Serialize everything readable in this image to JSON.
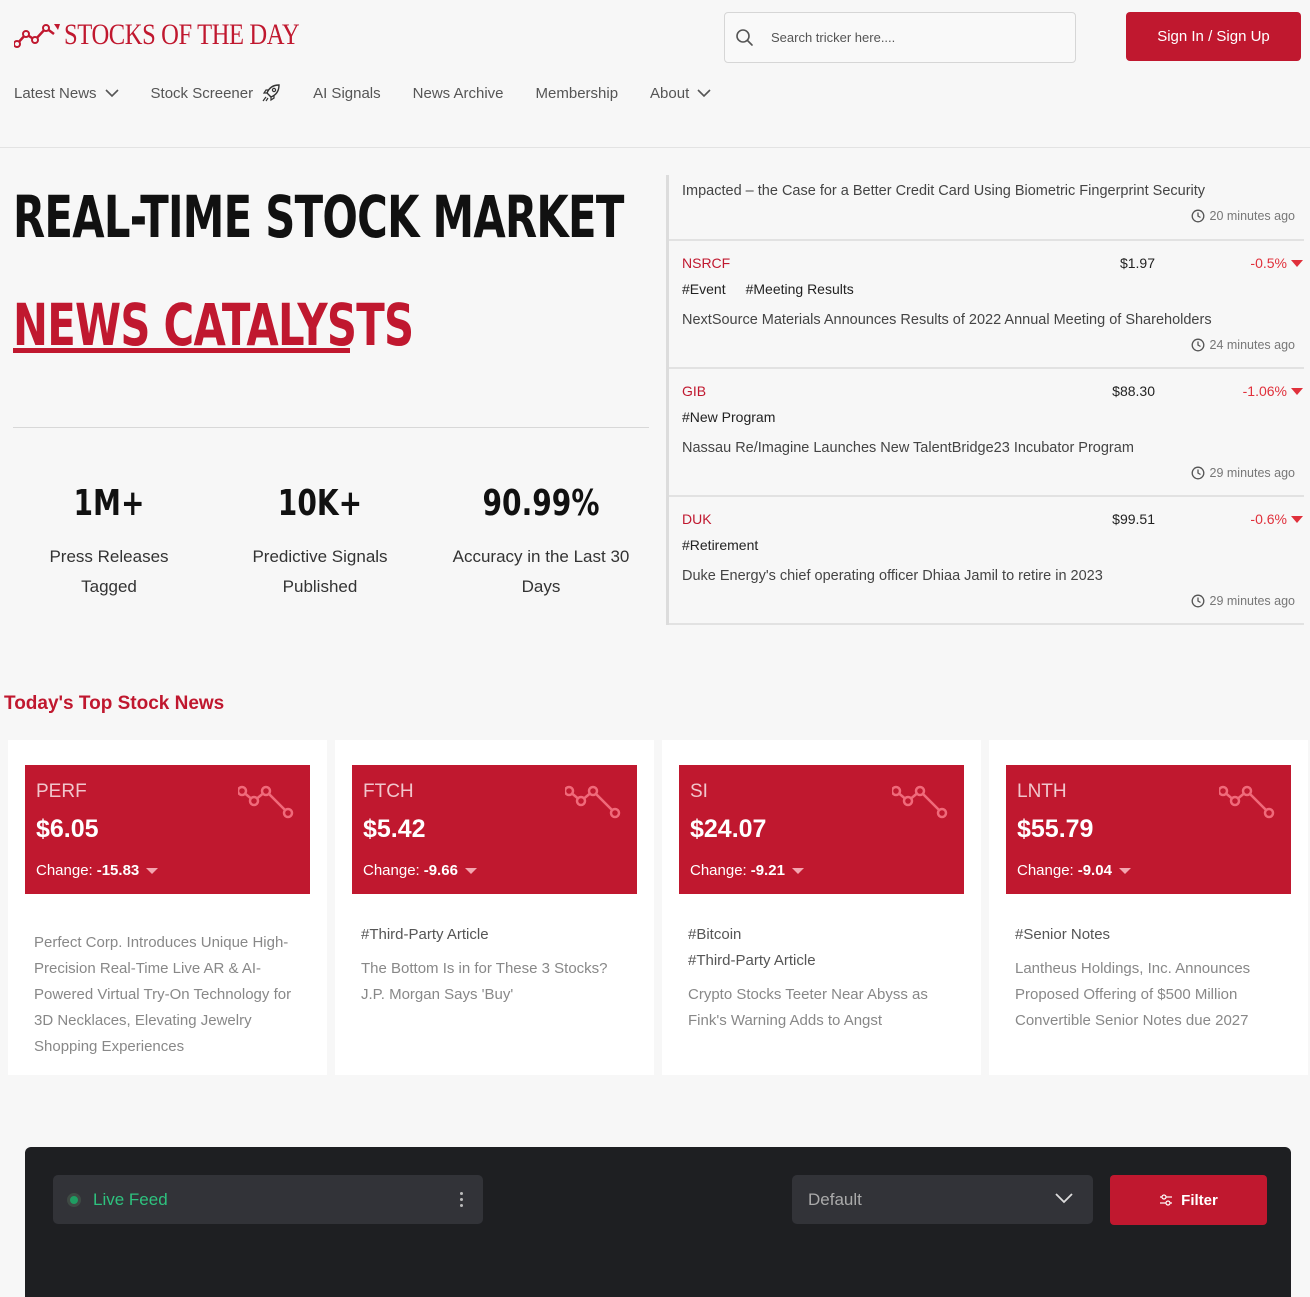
{
  "header": {
    "logo_text": "STOCKS OF THE DAY",
    "search_placeholder": "Search tricker here....",
    "signin_label": "Sign In / Sign Up"
  },
  "nav": {
    "items": [
      {
        "label": "Latest News",
        "has_chevron": true
      },
      {
        "label": "Stock Screener",
        "has_rocket": true
      },
      {
        "label": "AI Signals"
      },
      {
        "label": "News Archive"
      },
      {
        "label": "Membership"
      },
      {
        "label": "About",
        "has_chevron": true
      }
    ]
  },
  "hero": {
    "title": "REAL-TIME STOCK MARKET",
    "subtitle": "NEWS CATALYSTS",
    "stats": [
      {
        "value": "1M+",
        "label_line1": "Press Releases",
        "label_line2": "Tagged"
      },
      {
        "value": "10K+",
        "label_line1": "Predictive Signals",
        "label_line2": "Published"
      },
      {
        "value": "90.99%",
        "label_line1": "Accuracy in the Last 30",
        "label_line2": "Days"
      }
    ]
  },
  "feed": {
    "partial_item": {
      "headline": "Impacted – the Case for a Better Credit Card Using Biometric Fingerprint Security",
      "time": "20 minutes ago"
    },
    "items": [
      {
        "ticker": "NSRCF",
        "price": "$1.97",
        "change": "-0.5%",
        "tags": [
          "#Event",
          "#Meeting Results"
        ],
        "headline": "NextSource Materials Announces Results of 2022 Annual Meeting of Shareholders",
        "time": "24 minutes ago"
      },
      {
        "ticker": "GIB",
        "price": "$88.30",
        "change": "-1.06%",
        "tags": [
          "#New Program"
        ],
        "headline": "Nassau Re/Imagine Launches New TalentBridge23 Incubator Program",
        "time": "29 minutes ago"
      },
      {
        "ticker": "DUK",
        "price": "$99.51",
        "change": "-0.6%",
        "tags": [
          "#Retirement"
        ],
        "headline": "Duke Energy's chief operating officer Dhiaa Jamil to retire in 2023",
        "time": "29 minutes ago"
      }
    ]
  },
  "top_news": {
    "title": "Today's Top Stock News",
    "cards": [
      {
        "ticker": "PERF",
        "price": "$6.05",
        "change_label": "Change:",
        "change": "-15.83",
        "tags": [],
        "body": "Perfect Corp. Introduces Unique High-Precision Real-Time Live AR & AI-Powered Virtual Try-On Technology for 3D Necklaces, Elevating Jewelry Shopping Experiences"
      },
      {
        "ticker": "FTCH",
        "price": "$5.42",
        "change_label": "Change:",
        "change": "-9.66",
        "tags": [
          "#Third-Party Article"
        ],
        "body": "The Bottom Is in for These 3 Stocks? J.P. Morgan Says 'Buy'"
      },
      {
        "ticker": "SI",
        "price": "$24.07",
        "change_label": "Change:",
        "change": "-9.21",
        "tags": [
          "#Bitcoin",
          "#Third-Party Article"
        ],
        "body": "Crypto Stocks Teeter Near Abyss as Fink's Warning Adds to Angst"
      },
      {
        "ticker": "LNTH",
        "price": "$55.79",
        "change_label": "Change:",
        "change": "-9.04",
        "tags": [
          "#Senior Notes"
        ],
        "body": "Lantheus Holdings, Inc. Announces Proposed Offering of $500 Million Convertible Senior Notes due 2027"
      }
    ]
  },
  "live_feed": {
    "label": "Live Feed",
    "select_value": "Default",
    "filter_label": "Filter"
  },
  "colors": {
    "brand": "#c0182f",
    "down": "#e0303b",
    "live": "#2ec27e"
  }
}
